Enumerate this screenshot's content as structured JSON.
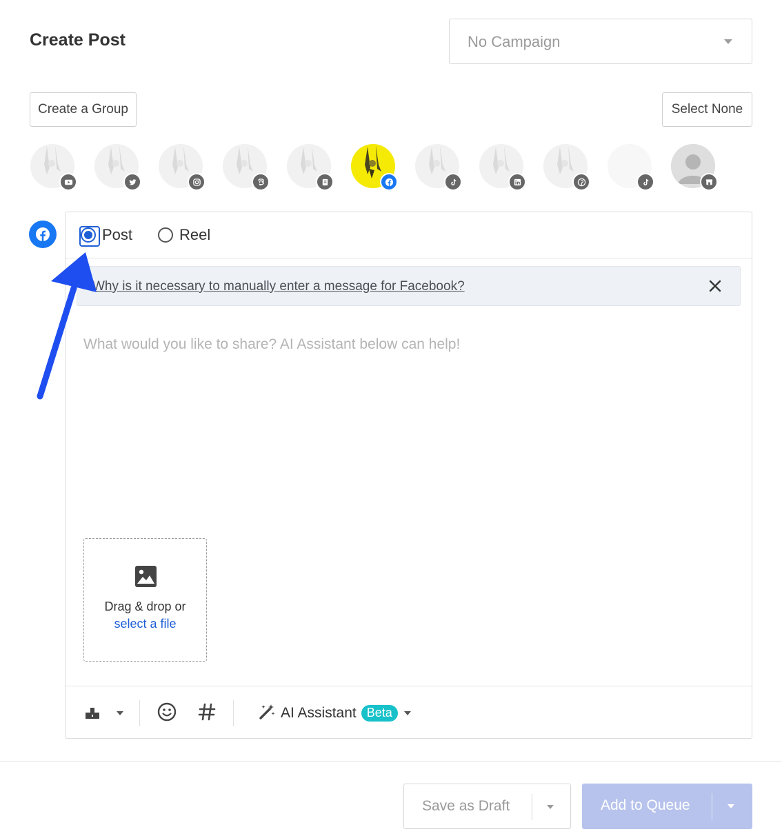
{
  "header": {
    "title": "Create Post",
    "campaign_select": {
      "value": "No Campaign"
    }
  },
  "accounts_bar": {
    "create_group_label": "Create a Group",
    "select_none_label": "Select None",
    "accounts": [
      {
        "network": "youtube",
        "icon": "youtube-icon",
        "selected": false
      },
      {
        "network": "twitter",
        "icon": "twitter-icon",
        "selected": false
      },
      {
        "network": "instagram",
        "icon": "instagram-icon",
        "selected": false
      },
      {
        "network": "mastodon",
        "icon": "mastodon-icon",
        "selected": false
      },
      {
        "network": "google-business",
        "icon": "google-business-icon",
        "selected": false
      },
      {
        "network": "facebook",
        "icon": "facebook-icon",
        "selected": true
      },
      {
        "network": "tiktok",
        "icon": "tiktok-icon",
        "selected": false
      },
      {
        "network": "linkedin",
        "icon": "linkedin-icon",
        "selected": false
      },
      {
        "network": "pinterest",
        "icon": "pinterest-icon",
        "selected": false
      },
      {
        "network": "tiktok",
        "icon": "tiktok-icon",
        "selected": false
      },
      {
        "network": "google-business",
        "icon": "google-business-icon",
        "selected": false
      }
    ]
  },
  "editor": {
    "network_icon": "facebook-icon",
    "post_type": {
      "options": [
        "Post",
        "Reel"
      ],
      "selected": "Post"
    },
    "info_banner": {
      "link_text": "Why is it necessary to manually enter a message for Facebook?"
    },
    "compose": {
      "placeholder": "What would you like to share? AI Assistant below can help!",
      "value": ""
    },
    "dropzone": {
      "text": "Drag & drop or",
      "link": "select a file"
    },
    "toolbar": {
      "ai_assistant_label": "AI Assistant",
      "beta_badge": "Beta"
    }
  },
  "footer": {
    "save_draft_label": "Save as Draft",
    "add_to_queue_label": "Add to Queue"
  },
  "colors": {
    "accent": "#1f5fd6",
    "facebook": "#1877f2",
    "beta": "#17c1c9",
    "primary_disabled": "#b7c3ec",
    "annotation_arrow": "#1f4ef0"
  }
}
